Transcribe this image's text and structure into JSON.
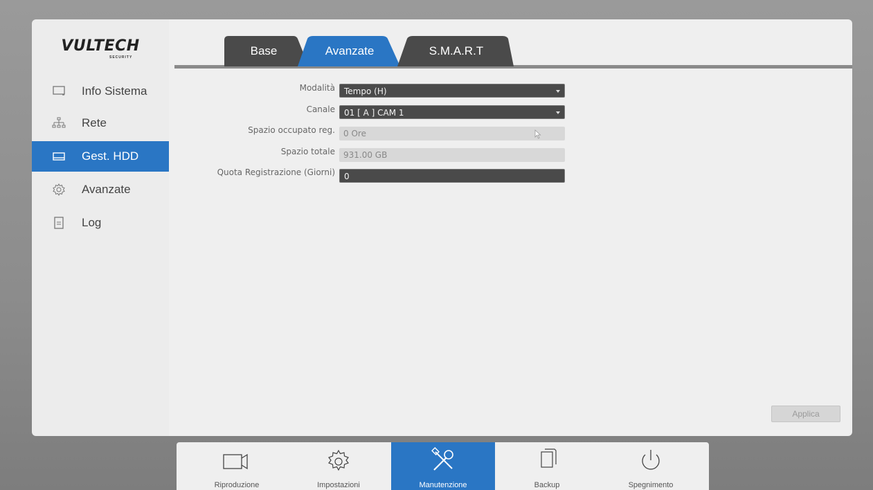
{
  "brand": {
    "logo": "VULTECH",
    "logo_sub": "SECURITY"
  },
  "sidebar": {
    "items": [
      {
        "label": "Info Sistema",
        "icon": "monitor-icon",
        "active": false
      },
      {
        "label": "Rete",
        "icon": "network-icon",
        "active": false
      },
      {
        "label": "Gest. HDD",
        "icon": "hdd-icon",
        "active": true
      },
      {
        "label": "Avanzate",
        "icon": "gear-icon",
        "active": false
      },
      {
        "label": "Log",
        "icon": "document-icon",
        "active": false
      }
    ]
  },
  "tabs": [
    {
      "label": "Base",
      "active": false
    },
    {
      "label": "Avanzate",
      "active": true
    },
    {
      "label": "S.M.A.R.T",
      "active": false
    }
  ],
  "form": {
    "mode": {
      "label": "Modalità",
      "value": "Tempo (H)"
    },
    "channel": {
      "label": "Canale",
      "value": "01 [ A ] CAM 1"
    },
    "used_space": {
      "label": "Spazio occupato reg.",
      "value": "0 Ore"
    },
    "total_space": {
      "label": "Spazio totale",
      "value": "931.00 GB"
    },
    "quota": {
      "label": "Quota Registrazione (Giorni)",
      "value": "0"
    }
  },
  "buttons": {
    "apply": "Applica"
  },
  "bottom_nav": [
    {
      "label": "Riproduzione",
      "icon": "camera-icon",
      "active": false
    },
    {
      "label": "Impostazioni",
      "icon": "gear-icon",
      "active": false
    },
    {
      "label": "Manutenzione",
      "icon": "tools-icon",
      "active": true
    },
    {
      "label": "Backup",
      "icon": "copy-icon",
      "active": false
    },
    {
      "label": "Spegnimento",
      "icon": "power-icon",
      "active": false
    }
  ],
  "colors": {
    "accent": "#2a76c4",
    "panel": "#efefef",
    "tab_dark": "#4a4a4a"
  }
}
